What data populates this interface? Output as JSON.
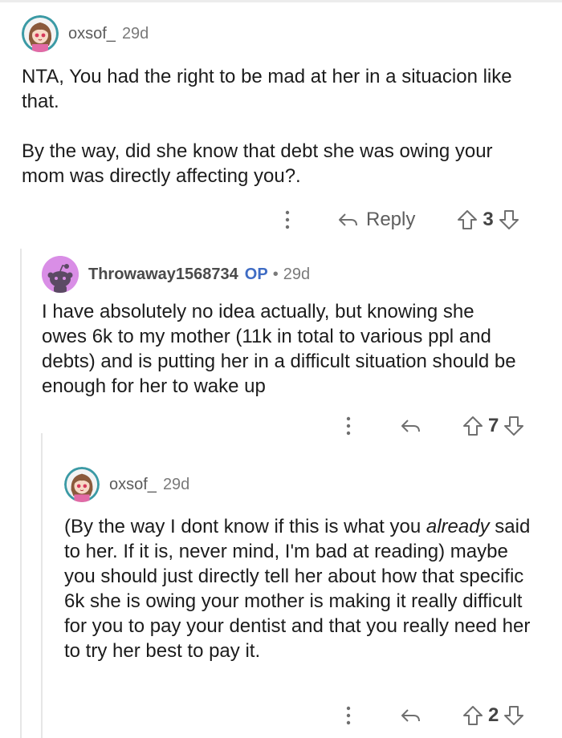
{
  "comments": [
    {
      "username": "oxsof_",
      "age": "29d",
      "paragraphs": [
        "NTA, You had the right to be mad at her in a situacion like that.",
        "By the way, did she know that debt she was owing your mom was directly affecting you?."
      ],
      "reply_label": "Reply",
      "votes": "3"
    },
    {
      "username": "Throwaway1568734",
      "op_badge": "OP",
      "separator": "•",
      "age": "29d",
      "paragraphs": [
        "I have absolutely no idea actually, but knowing she owes 6k to my mother (11k in total to various ppl and debts) and is putting her in a difficult situation should be enough for her to wake up"
      ],
      "votes": "7"
    },
    {
      "username": "oxsof_",
      "age": "29d",
      "text_before": "(By the way I dont know if this is what you ",
      "text_italic": "already",
      "text_after": " said to her. If it is, never mind, I'm bad at reading) maybe you should just directly tell her about how that specific 6k she is owing your mother is making it really difficult for you to pay your dentist and that you really need her to try her best to pay it.",
      "votes": "2"
    }
  ],
  "icons": {
    "more": "more-vertical-icon",
    "reply": "reply-arrow-icon",
    "upvote": "upvote-arrow-icon",
    "downvote": "downvote-arrow-icon"
  },
  "colors": {
    "op_badge": "#3f6cc4",
    "snoo_avatar_bg": "#d98ee6"
  }
}
